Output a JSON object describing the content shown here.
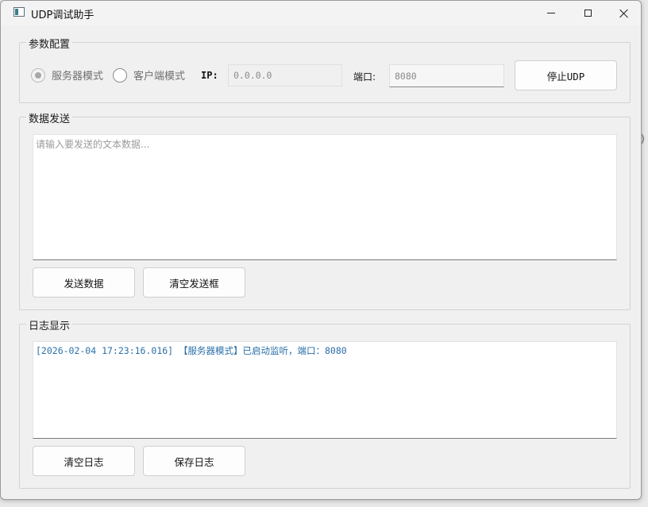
{
  "window": {
    "title": "UDP调试助手"
  },
  "config": {
    "group_title": "参数配置",
    "server_mode_label": "服务器模式",
    "client_mode_label": "客户端模式",
    "server_mode_selected": true,
    "ip_label": "IP:",
    "ip_value": "0.0.0.0",
    "port_label": "端口:",
    "port_value": "8080",
    "stop_button_label": "停止UDP"
  },
  "send": {
    "group_title": "数据发送",
    "placeholder": "请输入要发送的文本数据...",
    "send_button_label": "发送数据",
    "clear_button_label": "清空发送框"
  },
  "log": {
    "group_title": "日志显示",
    "lines": [
      "[2026-02-04 17:23:16.016] 【服务器模式】已启动监听，端口：8080"
    ],
    "clear_button_label": "清空日志",
    "save_button_label": "保存日志"
  },
  "colors": {
    "log_text": "#2a6fa8",
    "window_bg": "#f0f0f0"
  },
  "icons": {
    "app": "app-window-icon",
    "minimize": "minimize-icon",
    "maximize": "maximize-icon",
    "close": "close-icon"
  }
}
